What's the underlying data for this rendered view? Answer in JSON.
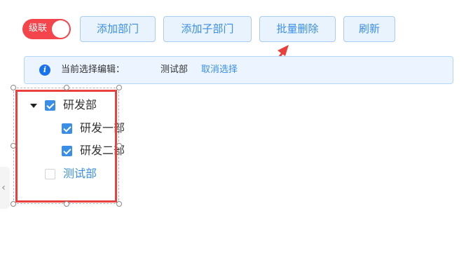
{
  "toolbar": {
    "cascade_switch": {
      "label": "级联",
      "on": true,
      "color": "#f3454b"
    },
    "buttons": [
      {
        "label": "添加部门"
      },
      {
        "label": "添加子部门"
      },
      {
        "label": "批量删除"
      },
      {
        "label": "刷新"
      }
    ]
  },
  "alert": {
    "icon": "info-icon",
    "prefix": "当前选择编辑：",
    "value": "测试部",
    "link": "取消选择"
  },
  "tree": {
    "nodes": [
      {
        "label": "研发部",
        "checked": true,
        "expanded": true
      },
      {
        "label": "研发一部",
        "checked": true
      },
      {
        "label": "研发二部",
        "checked": true
      },
      {
        "label": "测试部",
        "checked": false,
        "selected": true
      }
    ]
  },
  "colors": {
    "accent": "#3a8ee6",
    "annotation": "#e8403d",
    "info_blue": "#1872f0"
  }
}
